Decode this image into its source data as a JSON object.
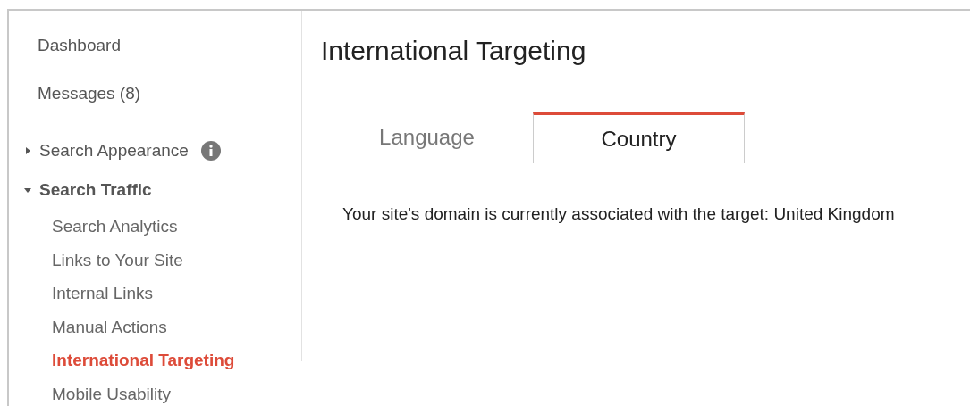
{
  "sidebar": {
    "items": [
      {
        "kind": "link",
        "label": "Dashboard",
        "selected": false
      },
      {
        "kind": "link",
        "label": "Messages (8)",
        "selected": false
      },
      {
        "kind": "group",
        "label": "Search Appearance",
        "expanded": false,
        "selected": false
      },
      {
        "kind": "group",
        "label": "Search Traffic",
        "expanded": true,
        "selected": false,
        "children": [
          {
            "label": "Search Analytics",
            "selected": false
          },
          {
            "label": "Links to Your Site",
            "selected": false
          },
          {
            "label": "Internal Links",
            "selected": false
          },
          {
            "label": "Manual Actions",
            "selected": false
          },
          {
            "label": "International Targeting",
            "selected": true
          },
          {
            "label": "Mobile Usability",
            "selected": false
          }
        ]
      }
    ]
  },
  "page": {
    "title": "International Targeting",
    "tabs": [
      {
        "label": "Language",
        "selected": false
      },
      {
        "label": "Country",
        "selected": true
      }
    ],
    "message": "Your site's domain is currently associated with the target: United Kingdom"
  }
}
